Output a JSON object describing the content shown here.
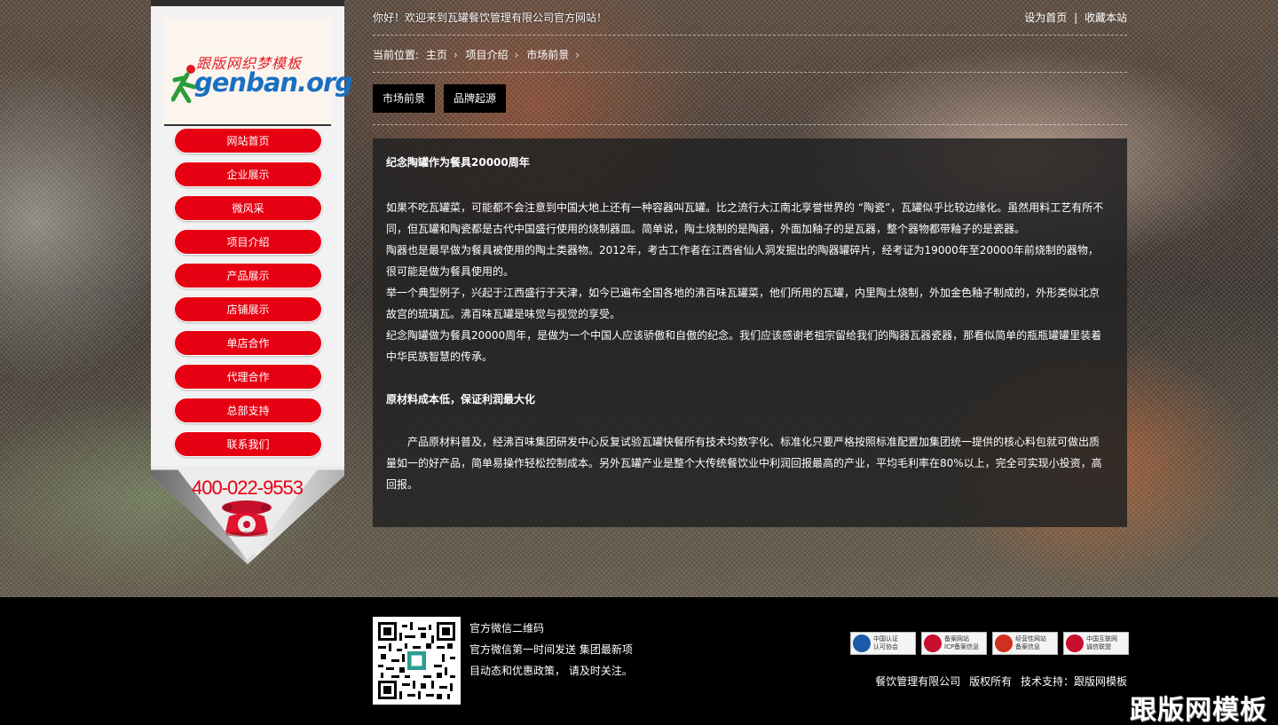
{
  "header": {
    "welcome": "你好！欢迎来到瓦罐餐饮管理有限公司官方网站！",
    "links": [
      "设为首页",
      "|",
      "收藏本站"
    ]
  },
  "logo": {
    "cn": "跟版网织梦模板",
    "en": "genban.org"
  },
  "sidebar": {
    "nav": [
      {
        "label": "网站首页"
      },
      {
        "label": "企业展示"
      },
      {
        "label": "微风采"
      },
      {
        "label": "项目介绍"
      },
      {
        "label": "产品展示"
      },
      {
        "label": "店铺展示"
      },
      {
        "label": "单店合作"
      },
      {
        "label": "代理合作"
      },
      {
        "label": "总部支持"
      },
      {
        "label": "联系我们"
      }
    ],
    "hotline": "400-022-9553"
  },
  "breadcrumb": {
    "prefix": "当前位置:",
    "items": [
      "主页",
      "项目介绍",
      "市场前景"
    ],
    "sep": "›"
  },
  "tabs": [
    {
      "label": "市场前景"
    },
    {
      "label": "品牌起源"
    }
  ],
  "article": {
    "title": "纪念陶罐作为餐具20000周年",
    "paragraphs": [
      "如果不吃瓦罐菜，可能都不会注意到中国大地上还有一种容器叫瓦罐。比之流行大江南北享誉世界的 “陶瓷”，瓦罐似乎比较边缘化。虽然用料工艺有所不同，但瓦罐和陶瓷都是古代中国盛行使用的烧制器皿。简单说，陶土烧制的是陶器，外面加釉子的是瓦器，整个器物都带釉子的是瓷器。",
      "陶器也是最早做为餐具被使用的陶土类器物。2012年，考古工作者在江西省仙人洞发掘出的陶器罐碎片，经考证为19000年至20000年前烧制的器物，很可能是做为餐具使用的。",
      "举一个典型例子，兴起于江西盛行于天津，如今已遍布全国各地的沸百味瓦罐菜，他们所用的瓦罐，内里陶土烧制，外加金色釉子制成的，外形类似北京故宫的琉璃瓦。沸百味瓦罐是味觉与视觉的享受。",
      "纪念陶罐做为餐具20000周年，是做为一个中国人应该骄傲和自傲的纪念。我们应该感谢老祖宗留给我们的陶器瓦器瓷器，那看似简单的瓶瓶罐罐里装着中华民族智慧的传承。"
    ],
    "subtitle": "原材料成本低，保证利润最大化",
    "paragraph2": "产品原材料普及，经沸百味集团研发中心反复试验瓦罐快餐所有技术均数字化、标准化只要严格按照标准配置加集团统一提供的核心料包就可做出质量如一的好产品，简单易操作轻松控制成本。另外瓦罐产业是整个大传统餐饮业中利润回报最高的产业，平均毛利率在80%以上，完全可实现小投资，高回报。"
  },
  "footer": {
    "qr_lines": [
      "官方微信二维码",
      "官方微信第一时间发送 集团最新项",
      "目动态和优惠政策， 请及时关注。"
    ],
    "badges": [
      {
        "line1": "中国认证",
        "line2": "认可协会",
        "color": "#1a5aa8"
      },
      {
        "line1": "备案网站",
        "line2": "ICP备案信息",
        "color": "#c8102e"
      },
      {
        "line1": "经营性网站",
        "line2": "备案信息",
        "color": "#d03020"
      },
      {
        "line1": "中国互联网",
        "line2": "诚信联盟",
        "color": "#c8102e"
      }
    ],
    "copyright": [
      "餐饮管理有限公司",
      "版权所有",
      "技术支持：跟版网模板"
    ],
    "watermark": "跟版网模板"
  }
}
